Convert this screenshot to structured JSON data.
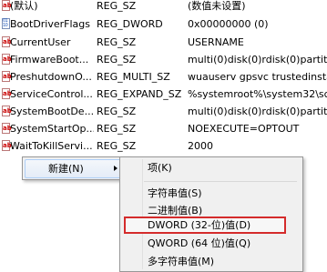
{
  "values": [
    {
      "name": "(默认)",
      "type": "REG_SZ",
      "data": "(数值未设置)",
      "icon": "string-value-icon"
    },
    {
      "name": "BootDriverFlags",
      "type": "REG_DWORD",
      "data": "0x00000000 (0)",
      "icon": "binary-value-icon"
    },
    {
      "name": "CurrentUser",
      "type": "REG_SZ",
      "data": "USERNAME",
      "icon": "string-value-icon"
    },
    {
      "name": "FirmwareBoot...",
      "type": "REG_SZ",
      "data": "multi(0)disk(0)rdisk(0)partition",
      "icon": "string-value-icon"
    },
    {
      "name": "PreshutdownO...",
      "type": "REG_MULTI_SZ",
      "data": "wuauserv gpsvc trustedinstalle",
      "icon": "string-value-icon"
    },
    {
      "name": "ServiceControl...",
      "type": "REG_EXPAND_SZ",
      "data": "%systemroot%\\system32\\scex",
      "icon": "string-value-icon"
    },
    {
      "name": "SystemBootDe...",
      "type": "REG_SZ",
      "data": "multi(0)disk(0)rdisk(0)partition",
      "icon": "string-value-icon"
    },
    {
      "name": "SystemStartOp...",
      "type": "REG_SZ",
      "data": " NOEXECUTE=OPTOUT",
      "icon": "string-value-icon"
    },
    {
      "name": "WaitToKillServi...",
      "type": "REG_SZ",
      "data": "2000",
      "icon": "string-value-icon"
    }
  ],
  "context_menu": {
    "new_label": "新建(N)"
  },
  "submenu": {
    "key": "项(K)",
    "string_value": "字符串值(S)",
    "binary_value": "二进制值(B)",
    "dword_value": "DWORD (32-位)值(D)",
    "qword_value": "QWORD (64 位)值(Q)",
    "multi_string_value": "多字符串值(M)"
  },
  "colors": {
    "highlight_border": "#d42b2b",
    "hover_border": "#aecff7"
  }
}
